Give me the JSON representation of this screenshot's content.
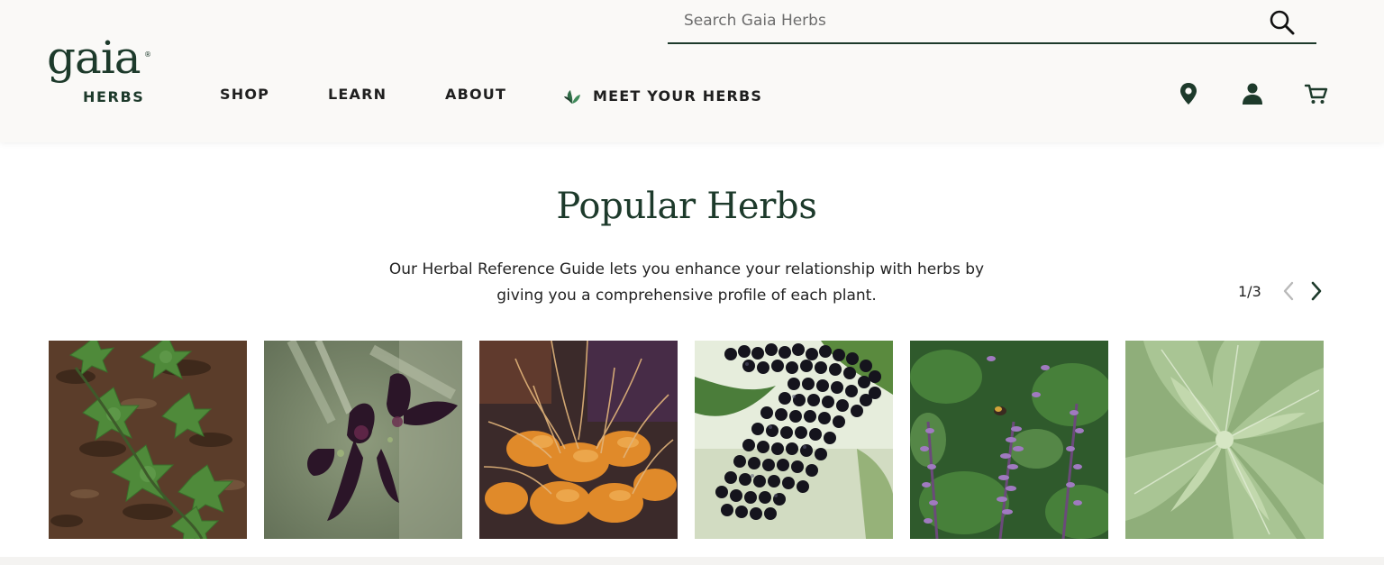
{
  "header": {
    "logo": {
      "word": "gaia",
      "sub": "HERBS",
      "mark": "®"
    },
    "search": {
      "placeholder": "Search Gaia Herbs",
      "value": ""
    },
    "nav": [
      {
        "label": "SHOP"
      },
      {
        "label": "LEARN"
      },
      {
        "label": "ABOUT"
      },
      {
        "label": "MEET YOUR HERBS",
        "icon": "leaf-icon"
      }
    ],
    "utility_icons": [
      "location-pin-icon",
      "account-icon",
      "cart-icon"
    ]
  },
  "main": {
    "title": "Popular Herbs",
    "subtitle_line1": "Our Herbal Reference Guide lets you enhance your relationship with herbs by",
    "subtitle_line2": "giving you a comprehensive profile of each plant.",
    "pager": {
      "current": "1/3"
    },
    "tiles": [
      {
        "name": "ivy-tile"
      },
      {
        "name": "orchid-tile"
      },
      {
        "name": "turmeric-tile"
      },
      {
        "name": "elderberry-tile"
      },
      {
        "name": "holy-basil-tile"
      },
      {
        "name": "ashwagandha-tile"
      }
    ]
  },
  "colors": {
    "brand_green": "#1d3a2b",
    "header_bg": "#faf9f7"
  }
}
